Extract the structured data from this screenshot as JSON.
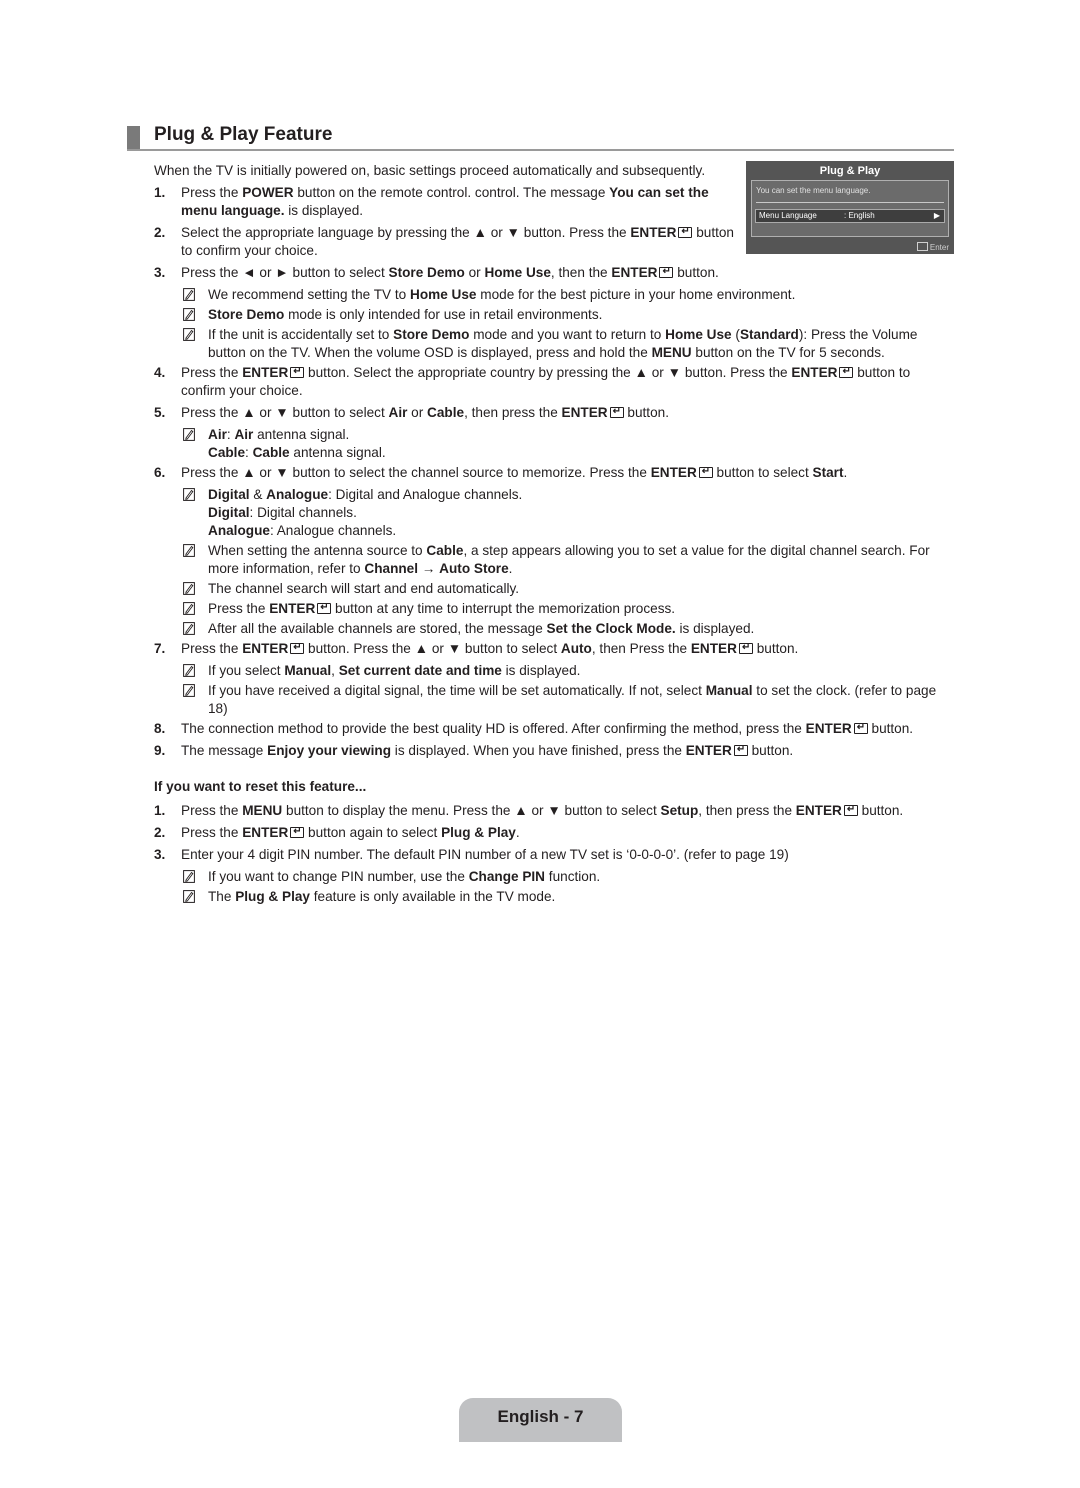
{
  "title": "Plug & Play Feature",
  "intro": "When the TV is initially powered on, basic settings proceed automatically and subsequently.",
  "osd": {
    "title": "Plug & Play",
    "message": "You can set the menu language.",
    "row_label": "Menu Language",
    "row_value": ": English",
    "row_arrow": "▶",
    "footer": "Enter"
  },
  "steps": [
    {
      "num": "1.",
      "html": "Press the <b>POWER</b> button on the remote control. control. The message <b>You can set the menu language.</b> is displayed."
    },
    {
      "num": "2.",
      "html": "Select the appropriate language by pressing the ▲ or ▼ button. Press the <b>ENTER</b>[E] button to confirm your choice."
    },
    {
      "num": "3.",
      "html": "Press the ◄ or ► button to select <b>Store Demo</b> or <b>Home Use</b>, then the <b>ENTER</b>[E] button.",
      "notes": [
        "We recommend setting the TV to <b>Home Use</b> mode for the best picture in your home environment.",
        "<b>Store Demo</b> mode is only intended for use in retail environments.",
        "If the unit is accidentally set to <b>Store Demo</b> mode and you want to return to <b>Home Use</b> (<b>Standard</b>): Press the Volume button on the TV. When the volume OSD is displayed, press and hold the <b>MENU</b> button on the TV for 5 seconds."
      ]
    },
    {
      "num": "4.",
      "html": "Press the <b>ENTER</b>[E] button. Select the appropriate country by pressing the ▲ or ▼ button. Press the <b>ENTER</b>[E] button to confirm your choice."
    },
    {
      "num": "5.",
      "html": "Press the ▲ or ▼ button to select <b>Air</b> or <b>Cable</b>, then press the <b>ENTER</b>[E] button.",
      "notes": [
        "<b>Air</b>: <b>Air</b> antenna signal.<br><b>Cable</b>: <b>Cable</b> antenna signal."
      ]
    },
    {
      "num": "6.",
      "html": "Press the ▲ or ▼ button to select the channel source to memorize. Press the <b>ENTER</b>[E] button to select <b>Start</b>.",
      "notes": [
        "<b>Digital</b> &amp; <b>Analogue</b>: Digital and Analogue channels.<br><b>Digital</b>: Digital channels.<br><b>Analogue</b>: Analogue channels.",
        "When setting the antenna source to <b>Cable</b>, a step appears allowing you to set a value for the digital channel search. For more information, refer to <b>Channel</b> → <b>Auto Store</b>.",
        "The channel search will start and end automatically.",
        "Press the <b>ENTER</b>[E] button at any time to interrupt the memorization process.",
        "After all the available channels are stored, the message <b>Set the Clock Mode.</b> is displayed."
      ]
    },
    {
      "num": "7.",
      "html": "Press the <b>ENTER</b>[E] button. Press the ▲ or ▼ button to select <b>Auto</b>, then Press the <b>ENTER</b>[E] button.",
      "notes": [
        "If you select <b>Manual</b>, <b>Set current date and time</b> is displayed.",
        "If you have received a digital signal, the time will be set automatically. If not, select <b>Manual</b> to set the clock. (refer to page 18)"
      ]
    },
    {
      "num": "8.",
      "html": "The connection method to provide the best quality HD is offered. After confirming the method, press the <b>ENTER</b>[E] button."
    },
    {
      "num": "9.",
      "html": "The message <b>Enjoy your viewing</b> is displayed. When you have finished, press the <b>ENTER</b>[E] button."
    }
  ],
  "reset_heading": "If you want to reset this feature...",
  "reset_steps": [
    {
      "num": "1.",
      "html": "Press the <b>MENU</b> button to display the menu. Press the ▲ or ▼ button to select <b>Setup</b>, then press the <b>ENTER</b>[E] button."
    },
    {
      "num": "2.",
      "html": "Press the <b>ENTER</b>[E] button again to select <b>Plug &amp; Play</b>."
    },
    {
      "num": "3.",
      "html": "Enter your 4 digit PIN number. The default PIN number of a new TV set is ‘0-0-0-0’. (refer to page 19)",
      "notes": [
        "If you want to change PIN number, use the <b>Change PIN</b> function.",
        "The <b>Plug &amp; Play</b> feature is only available in the TV mode."
      ]
    }
  ],
  "footer": "English - 7"
}
